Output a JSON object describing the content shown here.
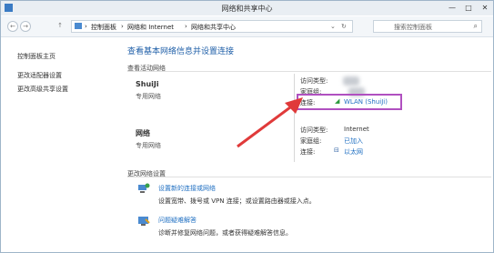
{
  "window": {
    "title": "网络和共享中心"
  },
  "window_buttons": {
    "minimize": "—",
    "maximize": "□",
    "close": "✕"
  },
  "nav": {
    "back": "←",
    "forward": "→",
    "up": "↑"
  },
  "address_bar": {
    "crumbs": [
      "控制面板",
      "网络和 Internet",
      "网络和共享中心"
    ],
    "separator": "›"
  },
  "search": {
    "placeholder": "搜索控制面板"
  },
  "sidebar": {
    "items": [
      {
        "label": "控制面板主页"
      },
      {
        "label": "更改适配器设置"
      },
      {
        "label": "更改高级共享设置"
      }
    ]
  },
  "main": {
    "heading": "查看基本网络信息并设置连接",
    "active_networks_title": "查看活动网络",
    "networks": [
      {
        "name": "ShuiJi",
        "type": "专用网络",
        "access_type_label": "访问类型:",
        "access_type_value": "",
        "homegroup_label": "家庭组:",
        "homegroup_value": "",
        "connection_label": "连接:",
        "connection_value": "WLAN (ShuiJi)"
      },
      {
        "name": "网络",
        "type": "专用网络",
        "access_type_label": "访问类型:",
        "access_type_value": "Internet",
        "homegroup_label": "家庭组:",
        "homegroup_value": "已加入",
        "connection_label": "连接:",
        "connection_value": "以太网"
      }
    ],
    "change_settings_title": "更改网络设置",
    "actions": [
      {
        "title": "设置新的连接或网络",
        "desc": "设置宽带、拨号或 VPN 连接；或设置路由器或接入点。"
      },
      {
        "title": "问题疑难解答",
        "desc": "诊断并修复网络问题，或者获得疑难解答信息。"
      }
    ]
  },
  "colors": {
    "accent": "#1f5fa8",
    "highlight_box": "#b050c0",
    "arrow": "#e03a3a"
  }
}
